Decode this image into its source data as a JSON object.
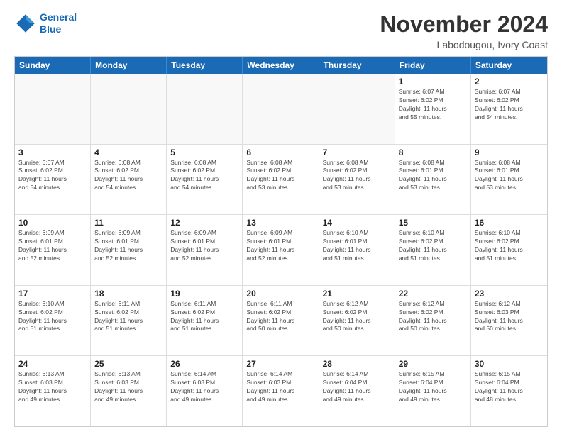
{
  "logo": {
    "line1": "General",
    "line2": "Blue"
  },
  "header": {
    "month": "November 2024",
    "location": "Labodougou, Ivory Coast"
  },
  "weekdays": [
    "Sunday",
    "Monday",
    "Tuesday",
    "Wednesday",
    "Thursday",
    "Friday",
    "Saturday"
  ],
  "weeks": [
    [
      {
        "day": "",
        "info": "",
        "empty": true
      },
      {
        "day": "",
        "info": "",
        "empty": true
      },
      {
        "day": "",
        "info": "",
        "empty": true
      },
      {
        "day": "",
        "info": "",
        "empty": true
      },
      {
        "day": "",
        "info": "",
        "empty": true
      },
      {
        "day": "1",
        "info": "Sunrise: 6:07 AM\nSunset: 6:02 PM\nDaylight: 11 hours\nand 55 minutes.",
        "empty": false
      },
      {
        "day": "2",
        "info": "Sunrise: 6:07 AM\nSunset: 6:02 PM\nDaylight: 11 hours\nand 54 minutes.",
        "empty": false
      }
    ],
    [
      {
        "day": "3",
        "info": "Sunrise: 6:07 AM\nSunset: 6:02 PM\nDaylight: 11 hours\nand 54 minutes.",
        "empty": false
      },
      {
        "day": "4",
        "info": "Sunrise: 6:08 AM\nSunset: 6:02 PM\nDaylight: 11 hours\nand 54 minutes.",
        "empty": false
      },
      {
        "day": "5",
        "info": "Sunrise: 6:08 AM\nSunset: 6:02 PM\nDaylight: 11 hours\nand 54 minutes.",
        "empty": false
      },
      {
        "day": "6",
        "info": "Sunrise: 6:08 AM\nSunset: 6:02 PM\nDaylight: 11 hours\nand 53 minutes.",
        "empty": false
      },
      {
        "day": "7",
        "info": "Sunrise: 6:08 AM\nSunset: 6:02 PM\nDaylight: 11 hours\nand 53 minutes.",
        "empty": false
      },
      {
        "day": "8",
        "info": "Sunrise: 6:08 AM\nSunset: 6:01 PM\nDaylight: 11 hours\nand 53 minutes.",
        "empty": false
      },
      {
        "day": "9",
        "info": "Sunrise: 6:08 AM\nSunset: 6:01 PM\nDaylight: 11 hours\nand 53 minutes.",
        "empty": false
      }
    ],
    [
      {
        "day": "10",
        "info": "Sunrise: 6:09 AM\nSunset: 6:01 PM\nDaylight: 11 hours\nand 52 minutes.",
        "empty": false
      },
      {
        "day": "11",
        "info": "Sunrise: 6:09 AM\nSunset: 6:01 PM\nDaylight: 11 hours\nand 52 minutes.",
        "empty": false
      },
      {
        "day": "12",
        "info": "Sunrise: 6:09 AM\nSunset: 6:01 PM\nDaylight: 11 hours\nand 52 minutes.",
        "empty": false
      },
      {
        "day": "13",
        "info": "Sunrise: 6:09 AM\nSunset: 6:01 PM\nDaylight: 11 hours\nand 52 minutes.",
        "empty": false
      },
      {
        "day": "14",
        "info": "Sunrise: 6:10 AM\nSunset: 6:01 PM\nDaylight: 11 hours\nand 51 minutes.",
        "empty": false
      },
      {
        "day": "15",
        "info": "Sunrise: 6:10 AM\nSunset: 6:02 PM\nDaylight: 11 hours\nand 51 minutes.",
        "empty": false
      },
      {
        "day": "16",
        "info": "Sunrise: 6:10 AM\nSunset: 6:02 PM\nDaylight: 11 hours\nand 51 minutes.",
        "empty": false
      }
    ],
    [
      {
        "day": "17",
        "info": "Sunrise: 6:10 AM\nSunset: 6:02 PM\nDaylight: 11 hours\nand 51 minutes.",
        "empty": false
      },
      {
        "day": "18",
        "info": "Sunrise: 6:11 AM\nSunset: 6:02 PM\nDaylight: 11 hours\nand 51 minutes.",
        "empty": false
      },
      {
        "day": "19",
        "info": "Sunrise: 6:11 AM\nSunset: 6:02 PM\nDaylight: 11 hours\nand 51 minutes.",
        "empty": false
      },
      {
        "day": "20",
        "info": "Sunrise: 6:11 AM\nSunset: 6:02 PM\nDaylight: 11 hours\nand 50 minutes.",
        "empty": false
      },
      {
        "day": "21",
        "info": "Sunrise: 6:12 AM\nSunset: 6:02 PM\nDaylight: 11 hours\nand 50 minutes.",
        "empty": false
      },
      {
        "day": "22",
        "info": "Sunrise: 6:12 AM\nSunset: 6:02 PM\nDaylight: 11 hours\nand 50 minutes.",
        "empty": false
      },
      {
        "day": "23",
        "info": "Sunrise: 6:12 AM\nSunset: 6:03 PM\nDaylight: 11 hours\nand 50 minutes.",
        "empty": false
      }
    ],
    [
      {
        "day": "24",
        "info": "Sunrise: 6:13 AM\nSunset: 6:03 PM\nDaylight: 11 hours\nand 49 minutes.",
        "empty": false
      },
      {
        "day": "25",
        "info": "Sunrise: 6:13 AM\nSunset: 6:03 PM\nDaylight: 11 hours\nand 49 minutes.",
        "empty": false
      },
      {
        "day": "26",
        "info": "Sunrise: 6:14 AM\nSunset: 6:03 PM\nDaylight: 11 hours\nand 49 minutes.",
        "empty": false
      },
      {
        "day": "27",
        "info": "Sunrise: 6:14 AM\nSunset: 6:03 PM\nDaylight: 11 hours\nand 49 minutes.",
        "empty": false
      },
      {
        "day": "28",
        "info": "Sunrise: 6:14 AM\nSunset: 6:04 PM\nDaylight: 11 hours\nand 49 minutes.",
        "empty": false
      },
      {
        "day": "29",
        "info": "Sunrise: 6:15 AM\nSunset: 6:04 PM\nDaylight: 11 hours\nand 49 minutes.",
        "empty": false
      },
      {
        "day": "30",
        "info": "Sunrise: 6:15 AM\nSunset: 6:04 PM\nDaylight: 11 hours\nand 48 minutes.",
        "empty": false
      }
    ]
  ]
}
